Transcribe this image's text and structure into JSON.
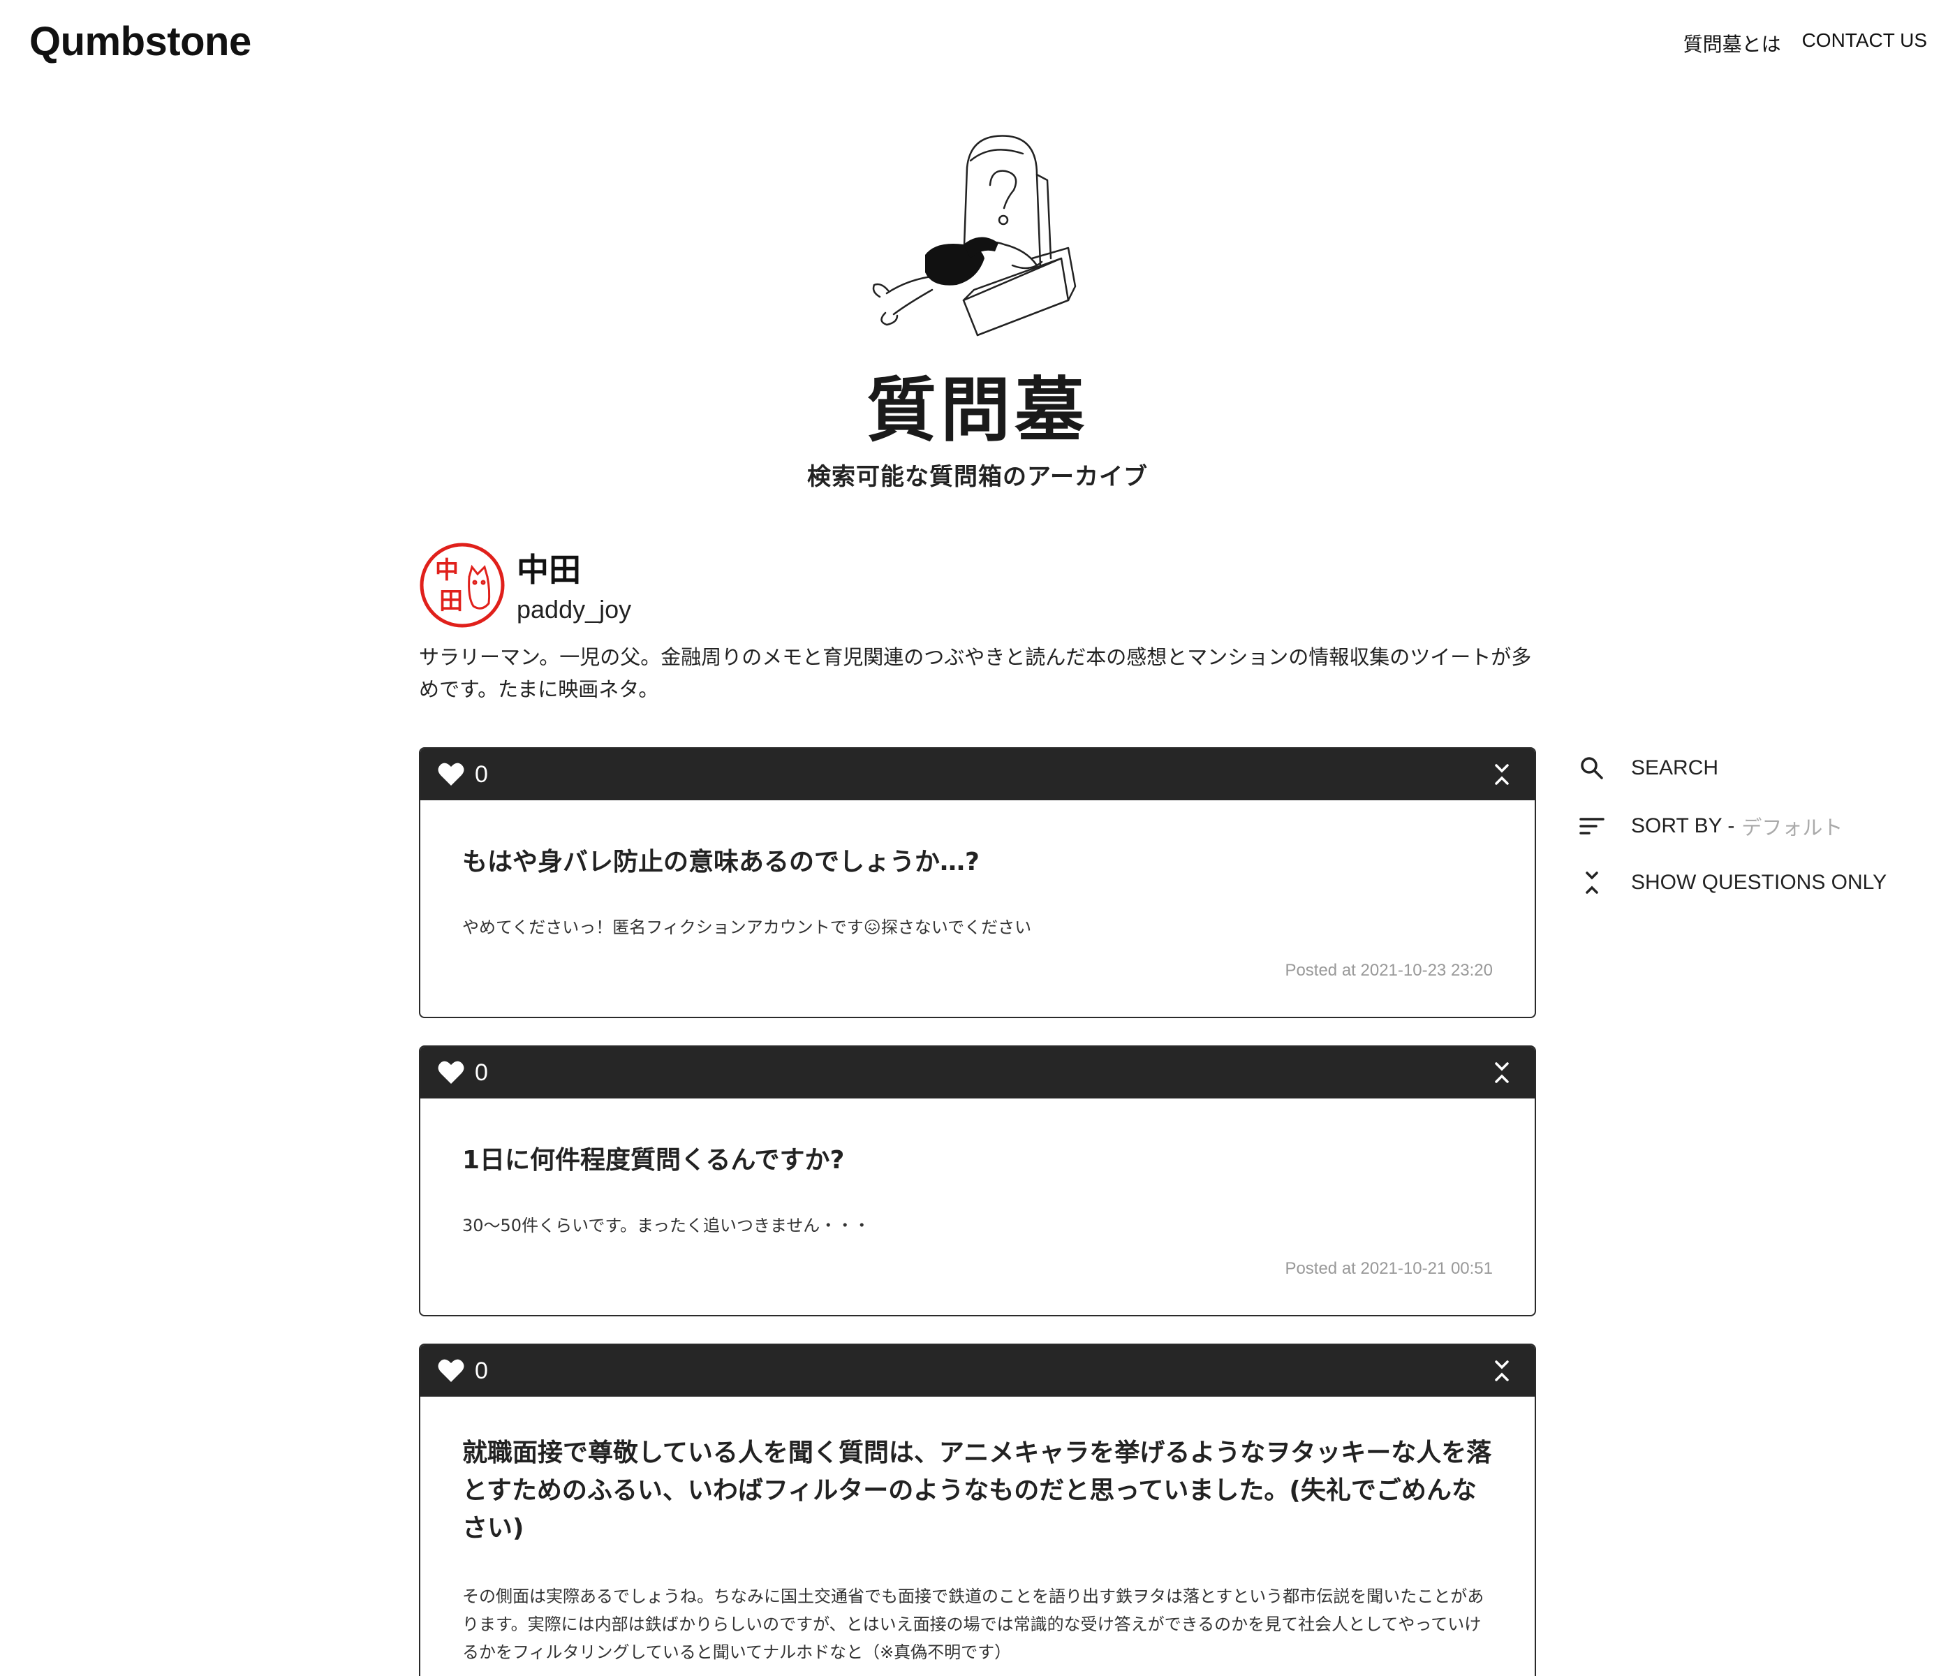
{
  "header": {
    "logo": "Qumbstone",
    "nav": [
      {
        "label": "質問墓とは"
      },
      {
        "label": "CONTACT US"
      }
    ]
  },
  "hero": {
    "title": "質問墓",
    "subtitle": "検索可能な質問箱のアーカイブ",
    "illustration_icon": "tombstone-question-illustration"
  },
  "profile": {
    "name": "中田",
    "handle": "paddy_joy",
    "bio": "サラリーマン。一児の父。金融周りのメモと育児関連のつぶやきと読んだ本の感想とマンションの情報収集のツイートが多めです。たまに映画ネタ。",
    "avatar_text": "中田"
  },
  "sidebar": {
    "search_label": "SEARCH",
    "sort_label": "SORT BY -",
    "sort_value": "デフォルト",
    "show_questions_label": "SHOW QUESTIONS ONLY"
  },
  "posts": [
    {
      "likes": "0",
      "question": "もはや身バレ防止の意味あるのでしょうか…?",
      "answer": "やめてくださいっ！匿名フィクションアカウントです😖探さないでください",
      "posted": "Posted at 2021-10-23 23:20"
    },
    {
      "likes": "0",
      "question": "1日に何件程度質問くるんですか?",
      "answer": "30〜50件くらいです。まったく追いつきません・・・",
      "posted": "Posted at 2021-10-21 00:51"
    },
    {
      "likes": "0",
      "question": "就職面接で尊敬している人を聞く質問は、アニメキャラを挙げるようなヲタッキーな人を落とすためのふるい、いわばフィルターのようなものだと思っていました。(失礼でごめんなさい)",
      "answer": "その側面は実際あるでしょうね。ちなみに国土交通省でも面接で鉄道のことを語り出す鉄ヲタは落とすという都市伝説を聞いたことがあります。実際には内部は鉄ばかりらしいのですが、とはいえ面接の場では常識的な受け答えができるのかを見て社会人としてやっていけるかをフィルタリングしていると聞いてナルホドなと（※真偽不明です）",
      "posted": ""
    }
  ],
  "colors": {
    "card_bar": "#262626",
    "stamp_red": "#e0201b",
    "muted": "#999999"
  }
}
